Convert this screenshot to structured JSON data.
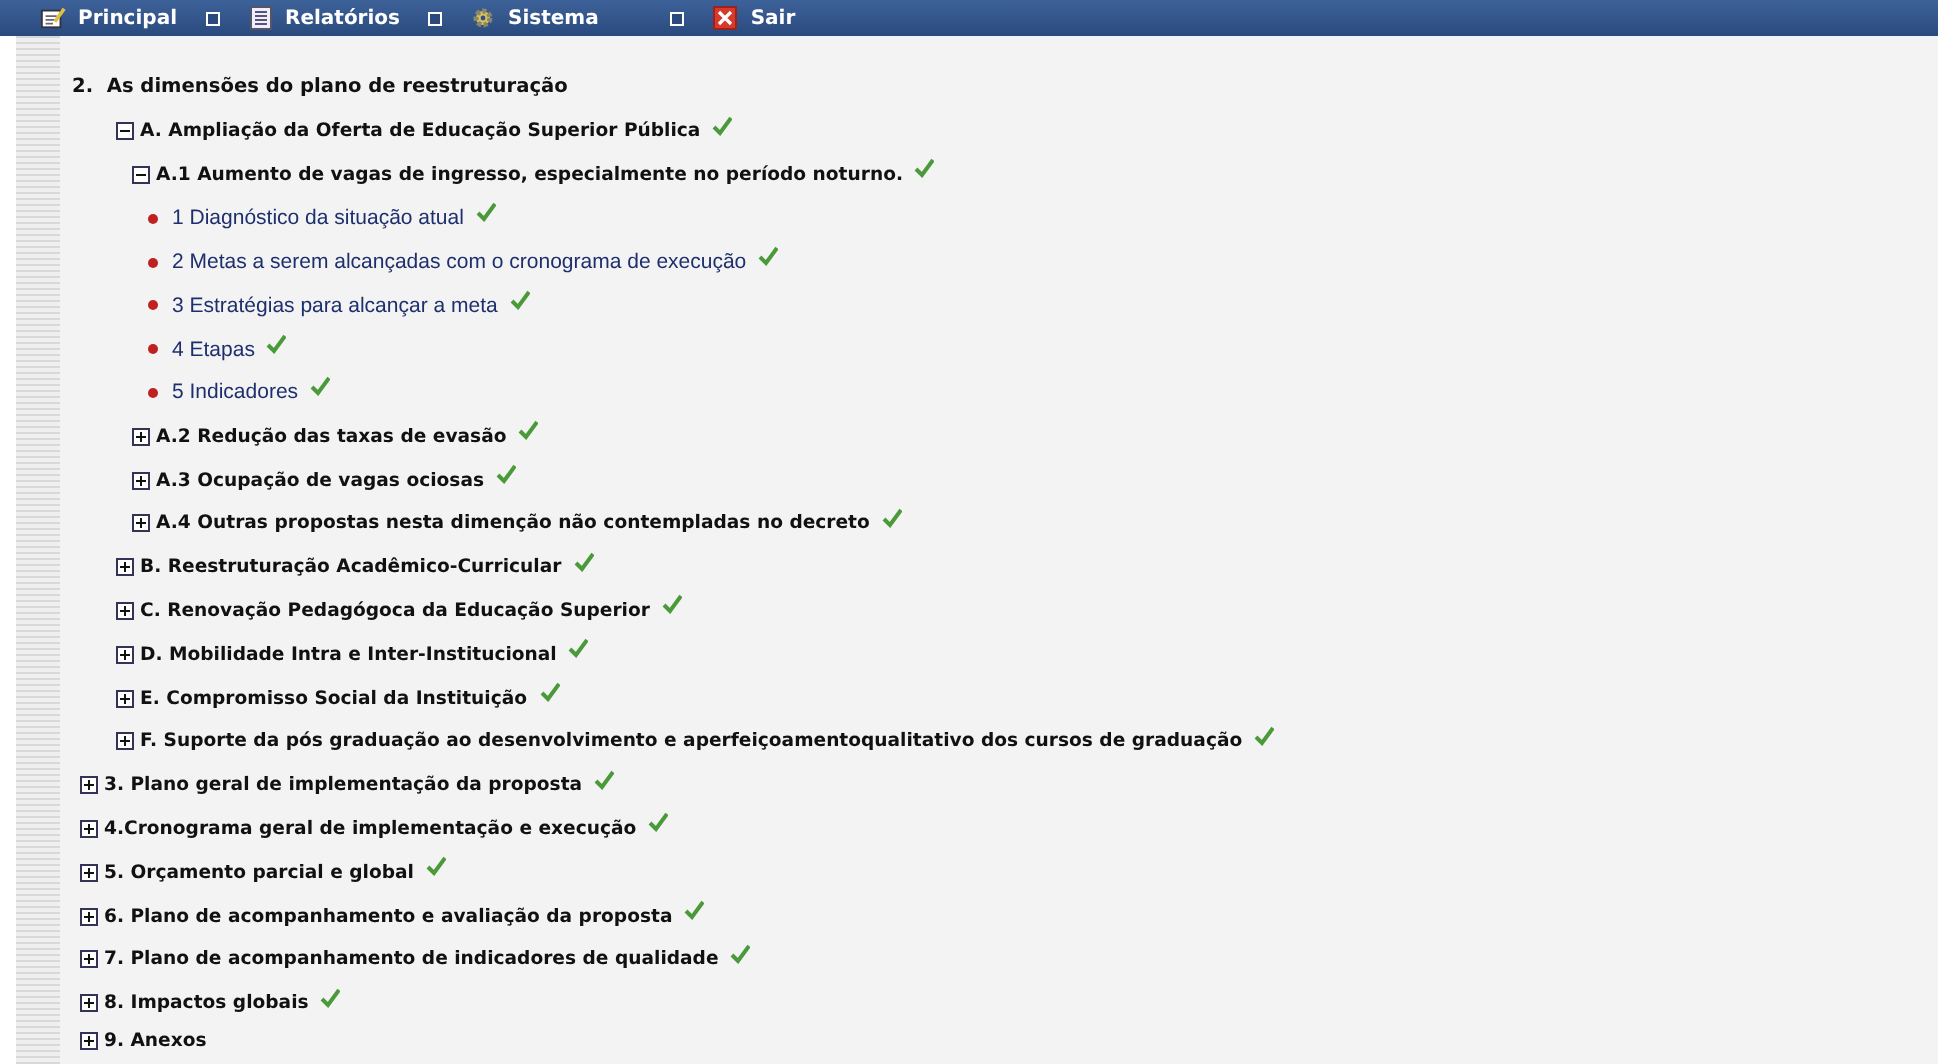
{
  "menu": [
    {
      "label": "Principal"
    },
    {
      "label": "Relatórios"
    },
    {
      "label": "Sistema"
    },
    {
      "label": "Sair"
    }
  ],
  "tree": [
    {
      "label": "2.  As dimensões do plano de reestruturação",
      "kind": "heading",
      "children": [
        {
          "label": "A. Ampliação da Oferta de Educação Superior Pública",
          "kind": "branch",
          "expanded": true,
          "done": true,
          "children": [
            {
              "label": "A.1 Aumento de vagas de ingresso, especialmente no período noturno.",
              "kind": "branch",
              "expanded": true,
              "done": true,
              "children": [
                {
                  "label": "1 Diagnóstico da situação atual",
                  "kind": "leaf",
                  "done": true
                },
                {
                  "label": "2 Metas a serem alcançadas com o cronograma de execução",
                  "kind": "leaf",
                  "done": true
                },
                {
                  "label": "3 Estratégias para alcançar a meta",
                  "kind": "leaf",
                  "done": true
                },
                {
                  "label": "4 Etapas",
                  "kind": "leaf",
                  "done": true
                },
                {
                  "label": "5 Indicadores",
                  "kind": "leaf",
                  "done": true
                }
              ]
            },
            {
              "label": "A.2 Redução das taxas de evasão",
              "kind": "branch",
              "expanded": false,
              "done": true
            },
            {
              "label": "A.3 Ocupação de vagas ociosas",
              "kind": "branch",
              "expanded": false,
              "done": true
            },
            {
              "label": "A.4 Outras propostas nesta dimenção não contempladas no decreto",
              "kind": "branch",
              "expanded": false,
              "done": true
            }
          ]
        },
        {
          "label": "B. Reestruturação Acadêmico-Curricular",
          "kind": "branch",
          "expanded": false,
          "done": true
        },
        {
          "label": "C. Renovação Pedagógoca da Educação Superior",
          "kind": "branch",
          "expanded": false,
          "done": true
        },
        {
          "label": "D. Mobilidade Intra e Inter-Institucional",
          "kind": "branch",
          "expanded": false,
          "done": true
        },
        {
          "label": "E. Compromisso Social da Instituição",
          "kind": "branch",
          "expanded": false,
          "done": true
        },
        {
          "label": "F. Suporte da pós graduação ao desenvolvimento e aperfeiçoamentoqualitativo dos cursos de graduação",
          "kind": "branch",
          "expanded": false,
          "done": true
        }
      ]
    },
    {
      "label": "3. Plano geral de implementação da proposta",
      "kind": "branch",
      "expanded": false,
      "done": true
    },
    {
      "label": "4.Cronograma geral de implementação e execução",
      "kind": "branch",
      "expanded": false,
      "done": true
    },
    {
      "label": "5. Orçamento parcial e global",
      "kind": "branch",
      "expanded": false,
      "done": true
    },
    {
      "label": "6. Plano de acompanhamento e avaliação da proposta",
      "kind": "branch",
      "expanded": false,
      "done": true
    },
    {
      "label": "7. Plano de acompanhamento de indicadores de qualidade",
      "kind": "branch",
      "expanded": false,
      "done": true
    },
    {
      "label": "8. Impactos globais",
      "kind": "branch",
      "expanded": false,
      "done": true
    },
    {
      "label": "9. Anexos",
      "kind": "branch",
      "expanded": false,
      "done": false
    }
  ]
}
